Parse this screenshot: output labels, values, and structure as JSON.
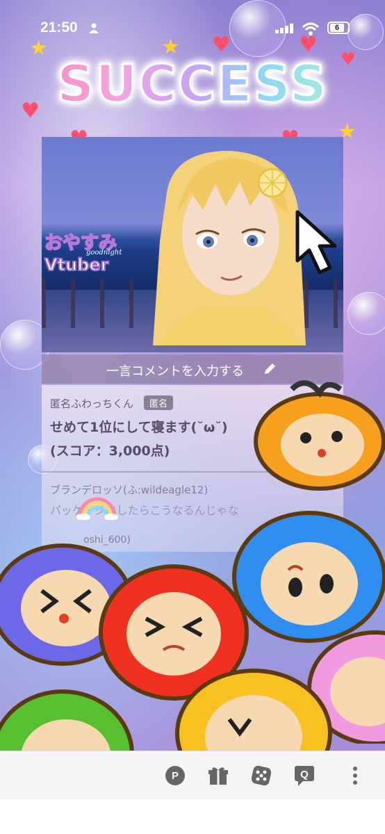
{
  "status_bar": {
    "time": "21:50",
    "battery": "6"
  },
  "banner": {
    "title": "SUCCESS"
  },
  "video": {
    "logo_line1": "おやすみ",
    "logo_line2": "goodnight",
    "logo_line3": "Vtuber"
  },
  "comment_input": {
    "placeholder": "一言コメントを入力する"
  },
  "comments": [
    {
      "name": "匿名ふわっちくん",
      "badge": "匿名",
      "text": "せめて1位にして寝ます(˘ω˘)",
      "score": "(スコア：3,000点)"
    },
    {
      "name": "ブランデロッソ(ふ:wildeagle12)",
      "text": "パッケージにしたらこうなるんじゃな"
    },
    {
      "name": "oshi_600)"
    }
  ],
  "bottom_bar": {
    "icons": [
      "points-icon",
      "gift-icon",
      "dice-icon",
      "question-icon",
      "more-icon"
    ]
  },
  "colors": {
    "accent_pink": "#f68fc6",
    "accent_purple": "#8a7f96",
    "bar_bg": "#f5f3f6"
  }
}
